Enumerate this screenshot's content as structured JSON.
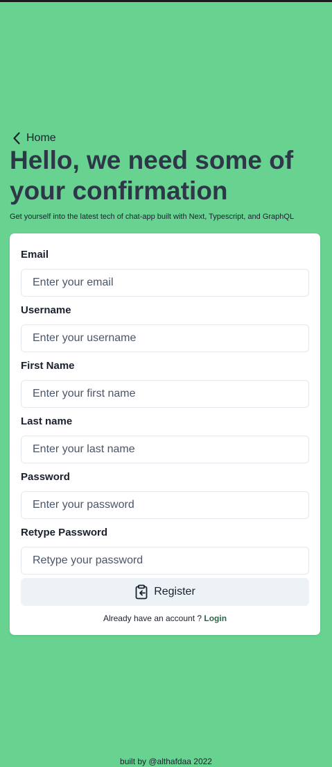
{
  "nav": {
    "home_label": "Home",
    "home_icon": "chevron-left-icon"
  },
  "header": {
    "title": "Hello, we need some of your confirmation",
    "subtitle": "Get yourself into the latest tech of chat-app built with Next, Typescript, and GraphQL"
  },
  "form": {
    "fields": [
      {
        "label": "Email",
        "placeholder": "Enter your email",
        "value": ""
      },
      {
        "label": "Username",
        "placeholder": "Enter your username",
        "value": ""
      },
      {
        "label": "First Name",
        "placeholder": "Enter your first name",
        "value": ""
      },
      {
        "label": "Last name",
        "placeholder": "Enter your last name",
        "value": ""
      },
      {
        "label": "Password",
        "placeholder": "Enter your password",
        "value": ""
      },
      {
        "label": "Retype Password",
        "placeholder": "Retype your password",
        "value": ""
      }
    ],
    "register_label": "Register",
    "register_icon": "clipboard-login-icon",
    "login_prompt": "Already have an account ?",
    "login_label": "Login"
  },
  "footer": {
    "text": "built by @althafdaa 2022"
  },
  "colors": {
    "background": "#68d391",
    "title": "#2d3748",
    "card": "#ffffff",
    "button": "#edf2f7",
    "login_link": "#276749"
  }
}
